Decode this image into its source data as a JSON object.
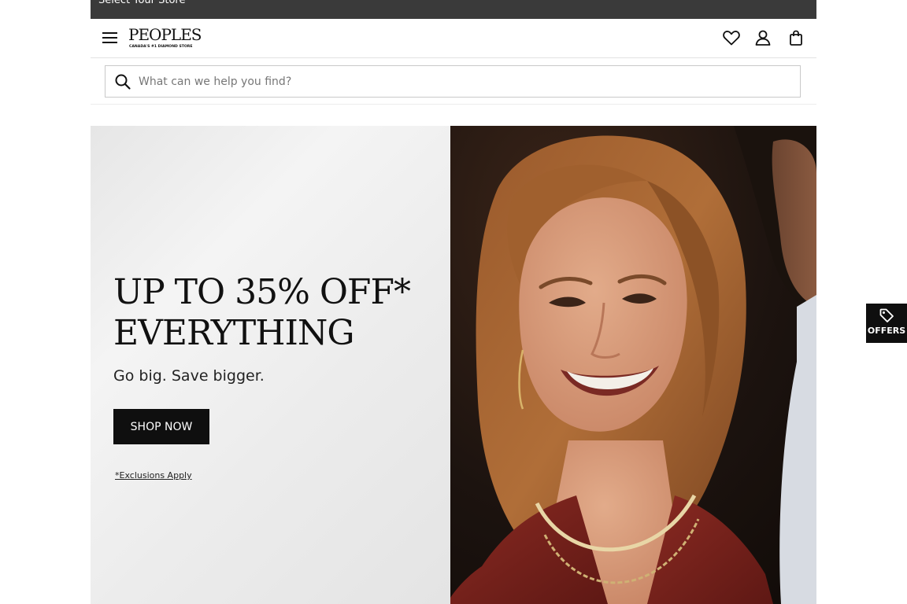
{
  "topbar": {
    "store_link": "Select Your Store"
  },
  "header": {
    "logo_text": "PEOPLES",
    "logo_tagline": "CANADA'S #1 DIAMOND STORE",
    "icons": [
      "menu-icon",
      "heart-icon",
      "account-icon",
      "bag-icon"
    ]
  },
  "search": {
    "placeholder": "What can we help you find?",
    "value": ""
  },
  "hero": {
    "headline_line1": "UP TO 35% OFF*",
    "headline_line2": "EVERYTHING",
    "subhead": "Go big. Save bigger.",
    "cta_label": "SHOP NOW",
    "disclaimer": "*Exclusions Apply"
  },
  "offers_tab": {
    "label": "OFFERS",
    "icon": "tag-icon"
  },
  "colors": {
    "topbar": "#3a3a3a",
    "button": "#0f0f0f",
    "text": "#111111"
  }
}
